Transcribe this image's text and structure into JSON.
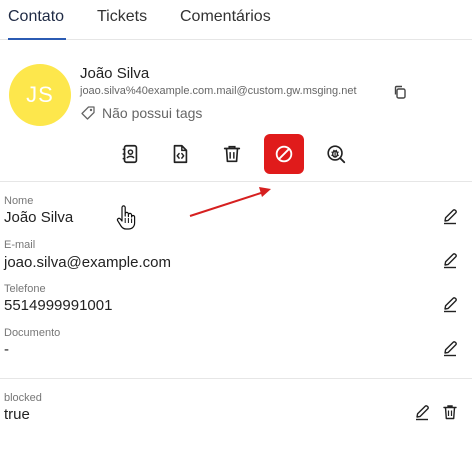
{
  "tabs": [
    {
      "label": "Contato",
      "active": true
    },
    {
      "label": "Tickets",
      "active": false
    },
    {
      "label": "Comentários",
      "active": false
    }
  ],
  "contact": {
    "initials": "JS",
    "name": "João Silva",
    "email": "joao.silva%40example.com.mail@custom.gw.msging.net",
    "tags_text": "Não possui tags"
  },
  "actions": [
    {
      "icon": "contact-card-icon"
    },
    {
      "icon": "code-file-icon"
    },
    {
      "icon": "trash-icon"
    },
    {
      "icon": "block-icon",
      "active": true
    },
    {
      "icon": "bug-search-icon"
    }
  ],
  "fields": [
    {
      "label": "Nome",
      "value": "João Silva"
    },
    {
      "label": "E-mail",
      "value": "joao.silva@example.com"
    },
    {
      "label": "Telefone",
      "value": "5514999991001"
    },
    {
      "label": "Documento",
      "value": "-"
    }
  ],
  "extras": [
    {
      "label": "blocked",
      "value": "true"
    }
  ],
  "colors": {
    "accent": "#2b5bb3",
    "avatar": "#fde74c",
    "danger": "#e01b1b",
    "annotation_arrow": "#d62020"
  }
}
